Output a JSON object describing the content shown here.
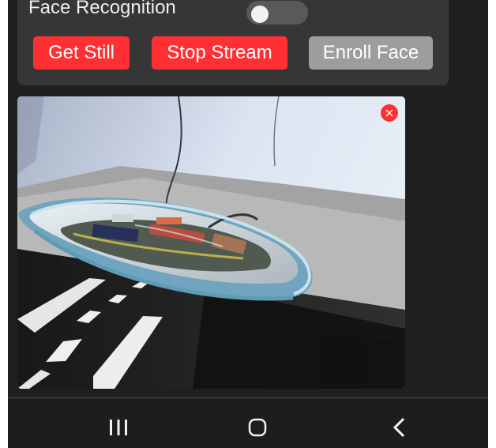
{
  "controls": {
    "face_recognition_label": "Face Recognition",
    "face_recognition_enabled": false,
    "get_still_label": "Get Still",
    "stop_stream_label": "Stop Stream",
    "enroll_face_label": "Enroll Face"
  },
  "stream": {
    "close_label": "×"
  },
  "navigation": {
    "recents_icon": "recent-apps-icon",
    "home_icon": "home-icon",
    "back_icon": "back-icon"
  },
  "colors": {
    "accent": "#ff3034",
    "disabled_button": "#9d9d9d",
    "panel_background": "#363636",
    "screen_background": "#1f1f1f"
  }
}
